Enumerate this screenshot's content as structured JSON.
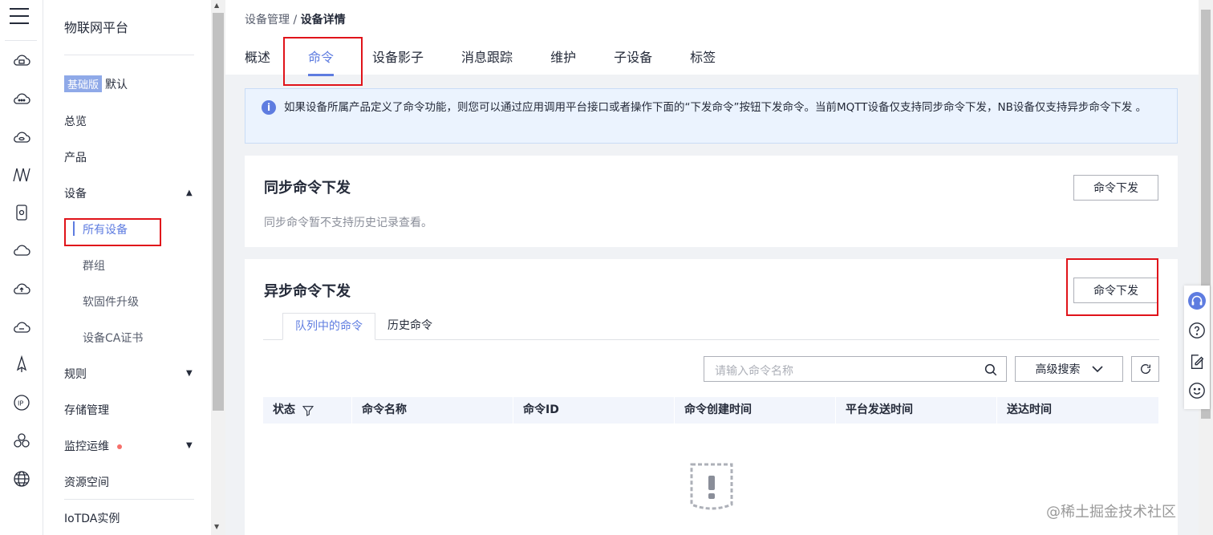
{
  "nav": {
    "title": "物联网平台",
    "edition_badge": "基础版",
    "edition_value": "默认",
    "items": {
      "overview": "总览",
      "product": "产品",
      "device": "设备",
      "all_devices": "所有设备",
      "group": "群组",
      "firmware": "软固件升级",
      "ca_cert": "设备CA证书",
      "rules": "规则",
      "storage": "存储管理",
      "monitor": "监控运维",
      "resource": "资源空间",
      "iotda": "IoTDA实例"
    }
  },
  "breadcrumb": {
    "parent": "设备管理",
    "separator": " / ",
    "current": "设备详情"
  },
  "tabs": [
    "概述",
    "命令",
    "设备影子",
    "消息跟踪",
    "维护",
    "子设备",
    "标签"
  ],
  "active_tab": "命令",
  "info_text": "如果设备所属产品定义了命令功能，则您可以通过应用调用平台接口或者操作下面的“下发命令”按钮下发命令。当前MQTT设备仅支持同步命令下发，NB设备仅支持异步命令下发 。",
  "sync": {
    "title": "同步命令下发",
    "button": "命令下发",
    "note": "同步命令暂不支持历史记录查看。"
  },
  "async": {
    "title": "异步命令下发",
    "button": "命令下发",
    "subtabs": [
      "队列中的命令",
      "历史命令"
    ],
    "search_placeholder": "请输入命令名称",
    "advanced_search": "高级搜索",
    "columns": [
      "状态",
      "命令名称",
      "命令ID",
      "命令创建时间",
      "平台发送时间",
      "送达时间"
    ]
  },
  "watermark": "@稀土掘金技术社区",
  "colors": {
    "accent": "#5e7ce0",
    "highlight_box": "#e0131a",
    "info_bg": "#ebf3fe"
  }
}
